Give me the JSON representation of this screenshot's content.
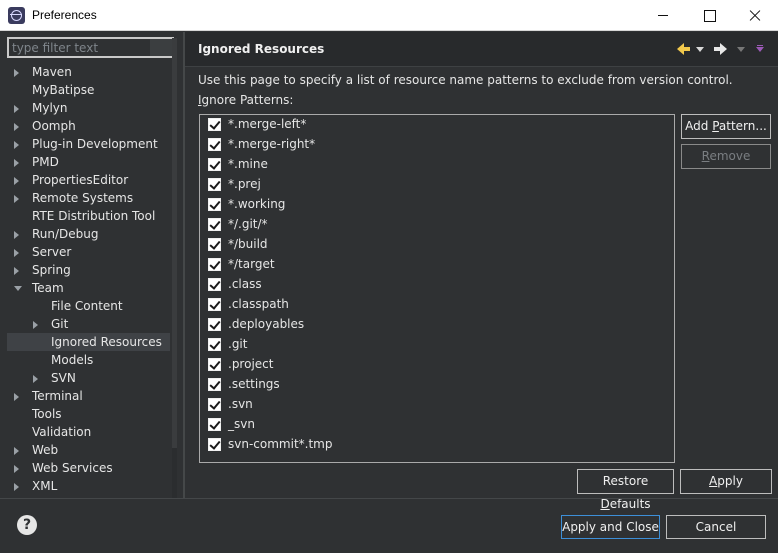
{
  "window": {
    "title": "Preferences",
    "controls": {
      "minimize": "minimize",
      "maximize": "maximize",
      "close": "close"
    }
  },
  "sidebar": {
    "filter_placeholder": "type filter text",
    "items": [
      {
        "label": "Maven",
        "level": 0,
        "state": "collapsed"
      },
      {
        "label": "MyBatipse",
        "level": 0,
        "state": "leaf"
      },
      {
        "label": "Mylyn",
        "level": 0,
        "state": "collapsed"
      },
      {
        "label": "Oomph",
        "level": 0,
        "state": "collapsed"
      },
      {
        "label": "Plug-in Development",
        "level": 0,
        "state": "collapsed"
      },
      {
        "label": "PMD",
        "level": 0,
        "state": "collapsed"
      },
      {
        "label": "PropertiesEditor",
        "level": 0,
        "state": "collapsed"
      },
      {
        "label": "Remote Systems",
        "level": 0,
        "state": "collapsed"
      },
      {
        "label": "RTE Distribution Tool",
        "level": 0,
        "state": "leaf"
      },
      {
        "label": "Run/Debug",
        "level": 0,
        "state": "collapsed"
      },
      {
        "label": "Server",
        "level": 0,
        "state": "collapsed"
      },
      {
        "label": "Spring",
        "level": 0,
        "state": "collapsed"
      },
      {
        "label": "Team",
        "level": 0,
        "state": "expanded"
      },
      {
        "label": "File Content",
        "level": 1,
        "state": "leaf"
      },
      {
        "label": "Git",
        "level": 1,
        "state": "collapsed"
      },
      {
        "label": "Ignored Resources",
        "level": 1,
        "state": "leaf",
        "selected": true
      },
      {
        "label": "Models",
        "level": 1,
        "state": "leaf"
      },
      {
        "label": "SVN",
        "level": 1,
        "state": "collapsed"
      },
      {
        "label": "Terminal",
        "level": 0,
        "state": "collapsed"
      },
      {
        "label": "Tools",
        "level": 0,
        "state": "leaf"
      },
      {
        "label": "Validation",
        "level": 0,
        "state": "leaf"
      },
      {
        "label": "Web",
        "level": 0,
        "state": "collapsed"
      },
      {
        "label": "Web Services",
        "level": 0,
        "state": "collapsed"
      },
      {
        "label": "XML",
        "level": 0,
        "state": "collapsed"
      }
    ]
  },
  "page": {
    "title": "Ignored Resources",
    "description": "Use this page to specify a list of resource name patterns to exclude from version control.",
    "patterns_label_mnemonic": "I",
    "patterns_label_rest": "gnore Patterns:",
    "patterns": [
      {
        "text": "*.merge-left*",
        "checked": true
      },
      {
        "text": "*.merge-right*",
        "checked": true
      },
      {
        "text": "*.mine",
        "checked": true
      },
      {
        "text": "*.prej",
        "checked": true
      },
      {
        "text": "*.working",
        "checked": true
      },
      {
        "text": "*/.git/*",
        "checked": true
      },
      {
        "text": "*/build",
        "checked": true
      },
      {
        "text": "*/target",
        "checked": true
      },
      {
        "text": ".class",
        "checked": true
      },
      {
        "text": ".classpath",
        "checked": true
      },
      {
        "text": ".deployables",
        "checked": true
      },
      {
        "text": ".git",
        "checked": true
      },
      {
        "text": ".project",
        "checked": true
      },
      {
        "text": ".settings",
        "checked": true
      },
      {
        "text": ".svn",
        "checked": true
      },
      {
        "text": "_svn",
        "checked": true
      },
      {
        "text": "svn-commit*.tmp",
        "checked": true
      }
    ],
    "buttons": {
      "add_pre": "Add ",
      "add_mnemonic": "P",
      "add_post": "attern...",
      "remove_mnemonic": "R",
      "remove_post": "emove",
      "restore_pre": "Restore ",
      "restore_mnemonic": "D",
      "restore_post": "efaults",
      "apply_mnemonic": "A",
      "apply_post": "pply"
    }
  },
  "footer": {
    "help_glyph": "?",
    "apply_and_close": "Apply and Close",
    "cancel": "Cancel"
  },
  "icons": {
    "back": "back-arrow-icon",
    "forward": "forward-arrow-icon",
    "menu": "view-menu-icon",
    "help": "help-icon"
  },
  "colors": {
    "background": "#2f3133",
    "header": "#282a2c",
    "selection": "#3f4246",
    "back_arrow": "#f2c94c",
    "accent_border": "#3d8fd8"
  }
}
